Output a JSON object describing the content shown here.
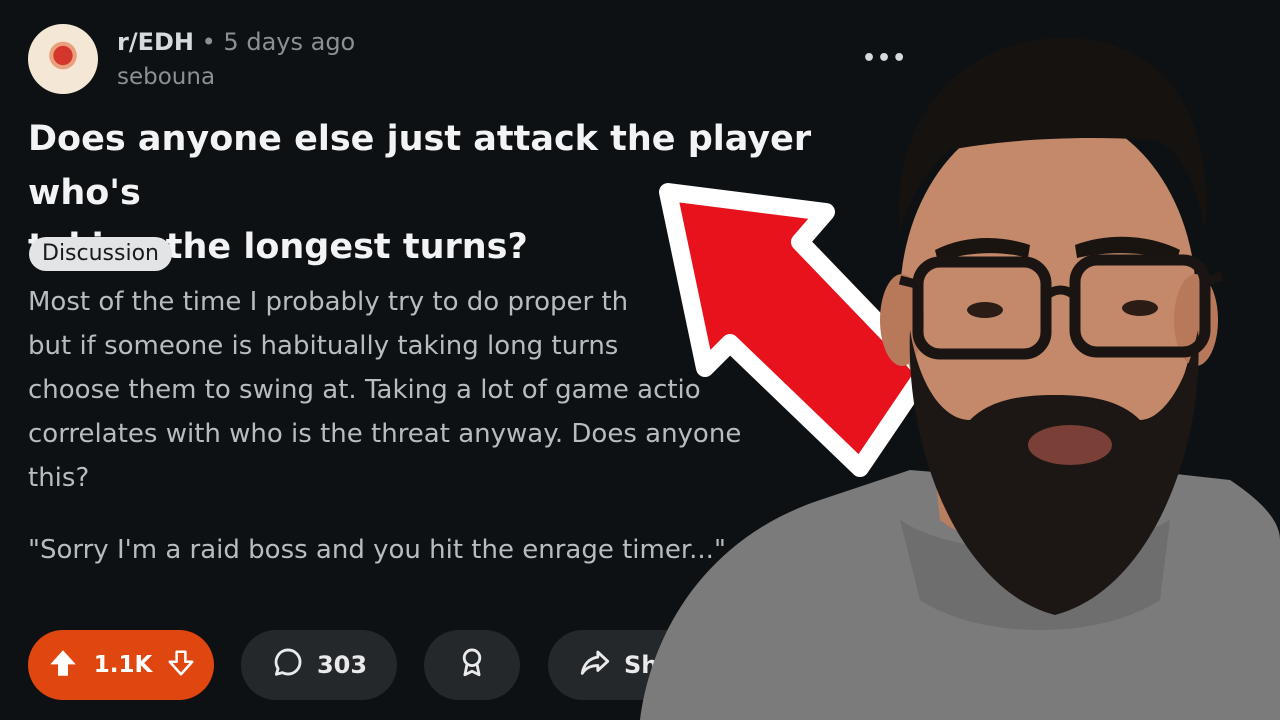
{
  "post": {
    "subreddit": "r/EDH",
    "meta": " • 5 days ago",
    "author": "sebouna",
    "more": "•••",
    "title_line1": "Does anyone else just attack the player who's",
    "title_line2": "taking the longest turns?",
    "flair": "Discussion",
    "body_lines": [
      "Most of the time I probably try to do proper th",
      "but if someone is habitually taking long turns",
      "choose them to swing at. Taking a lot of game actio",
      "correlates with who is the threat anyway. Does anyone",
      "this?"
    ],
    "quote": "\"Sorry I'm a raid boss and you hit the enrage timer...\""
  },
  "actions": {
    "votes": "1.1K",
    "comments": "303",
    "share": "Sh"
  },
  "colors": {
    "background": "#0e1113",
    "upvote_bg": "#e0460f",
    "pill_bg": "#24282b",
    "arrow_red": "#e8121c"
  },
  "icons": {
    "upvote": "upvote-arrow-icon",
    "downvote": "downvote-arrow-icon",
    "comment": "comment-bubble-icon",
    "award": "award-icon",
    "share": "share-arrow-icon"
  }
}
